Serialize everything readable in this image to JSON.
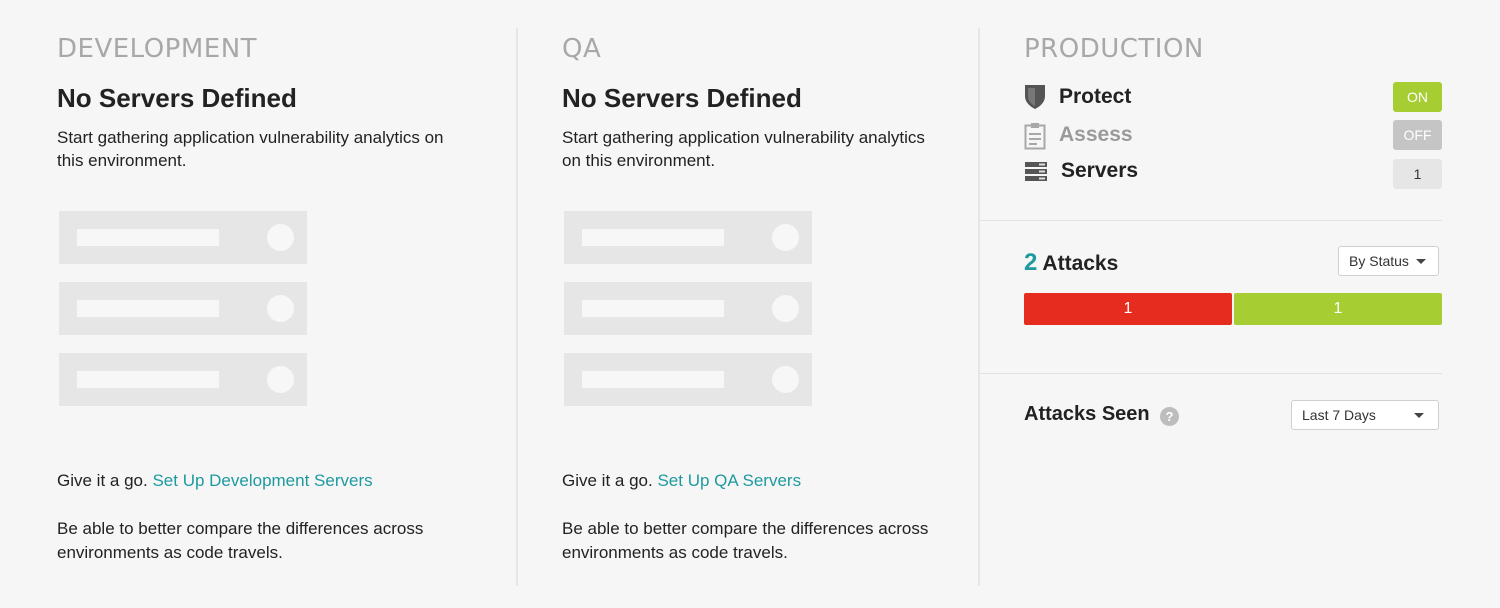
{
  "development": {
    "env_title": "DEVELOPMENT",
    "heading": "No Servers Defined",
    "description": "Start gathering application vulnerability analytics on this environment.",
    "cta_prefix": "Give it a go.",
    "cta_link": "Set Up Development Servers",
    "footer": "Be able to better compare the differences across environments as code travels."
  },
  "qa": {
    "env_title": "QA",
    "heading": "No Servers Defined",
    "description": "Start gathering application vulnerability analytics on this environment.",
    "cta_prefix": "Give it a go.",
    "cta_link": "Set Up QA Servers",
    "footer": "Be able to better compare the differences across environments as code travels."
  },
  "production": {
    "env_title": "PRODUCTION",
    "protect": {
      "label": "Protect",
      "toggle": "ON",
      "icon": "shield-icon"
    },
    "assess": {
      "label": "Assess",
      "toggle": "OFF",
      "icon": "clipboard-icon"
    },
    "servers": {
      "label": "Servers",
      "count": "1",
      "icon": "server-stack-icon"
    },
    "attacks": {
      "count": "2",
      "label": "Attacks",
      "dropdown": "By Status",
      "segments": [
        {
          "value": "1",
          "color": "#e52c1e"
        },
        {
          "value": "1",
          "color": "#a6cd32"
        }
      ]
    },
    "attacks_seen": {
      "label": "Attacks Seen",
      "help": "?",
      "dropdown": "Last 7 Days"
    }
  },
  "colors": {
    "accent": "#1d9aa0",
    "on": "#a6cd32",
    "off": "#c5c5c5",
    "attack_red": "#e52c1e",
    "attack_green": "#a6cd32"
  }
}
